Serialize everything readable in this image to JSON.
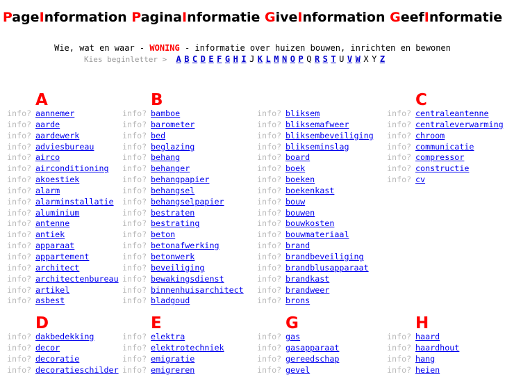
{
  "title": [
    {
      "cap": "P",
      "rest": "age"
    },
    {
      "cap": "I",
      "rest": "nformation "
    },
    {
      "cap": "P",
      "rest": "agina"
    },
    {
      "cap": "I",
      "rest": "nformatie "
    },
    {
      "cap": "G",
      "rest": "ive"
    },
    {
      "cap": "I",
      "rest": "nformation "
    },
    {
      "cap": "G",
      "rest": "eef"
    },
    {
      "cap": "I",
      "rest": "nformatie"
    }
  ],
  "tagline": {
    "before": "Wie, wat en waar - ",
    "highlight": "WONING",
    "after": " - informatie over huizen bouwen, inrichten en bewonen"
  },
  "letter_nav": {
    "label": "Kies beginletter >",
    "letters": [
      {
        "l": "A",
        "on": true
      },
      {
        "l": "B",
        "on": true
      },
      {
        "l": "C",
        "on": true
      },
      {
        "l": "D",
        "on": true
      },
      {
        "l": "E",
        "on": true
      },
      {
        "l": "F",
        "on": true
      },
      {
        "l": "G",
        "on": true
      },
      {
        "l": "H",
        "on": true
      },
      {
        "l": "I",
        "on": true
      },
      {
        "l": "J",
        "on": false
      },
      {
        "l": "K",
        "on": true
      },
      {
        "l": "L",
        "on": true
      },
      {
        "l": "M",
        "on": true
      },
      {
        "l": "N",
        "on": true
      },
      {
        "l": "O",
        "on": true
      },
      {
        "l": "P",
        "on": true
      },
      {
        "l": "Q",
        "on": false
      },
      {
        "l": "R",
        "on": true
      },
      {
        "l": "S",
        "on": true
      },
      {
        "l": "T",
        "on": true
      },
      {
        "l": "U",
        "on": false
      },
      {
        "l": "V",
        "on": true
      },
      {
        "l": "W",
        "on": true
      },
      {
        "l": "X",
        "on": false
      },
      {
        "l": "Y",
        "on": false
      },
      {
        "l": "Z",
        "on": true
      }
    ]
  },
  "info_label": "info?",
  "colors": {
    "accent": "#ff0000",
    "link": "#0000ee",
    "muted": "#bbbbbb"
  },
  "blocks": [
    {
      "columns": [
        {
          "header": "A",
          "items": [
            "aannemer",
            "aarde",
            "aardewerk",
            "adviesbureau",
            "airco",
            "airconditioning",
            "akoestiek",
            "alarm",
            "alarminstallatie",
            "aluminium",
            "antenne",
            "antiek",
            "apparaat",
            "appartement",
            "architect",
            "architectenbureau",
            "artikel",
            "asbest"
          ]
        },
        {
          "header": "B",
          "items": [
            "bamboe",
            "barometer",
            "bed",
            "beglazing",
            "behang",
            "behanger",
            "behangpapier",
            "behangsel",
            "behangselpapier",
            "bestraten",
            "bestrating",
            "beton",
            "betonafwerking",
            "betonwerk",
            "beveiliging",
            "bewakingsdienst",
            "binnenhuisarchitect",
            "bladgoud"
          ]
        },
        {
          "header": "",
          "items": [
            "bliksem",
            "bliksemafweer",
            "bliksembeveiliging",
            "blikseminslag",
            "board",
            "boek",
            "boeken",
            "boekenkast",
            "bouw",
            "bouwen",
            "bouwkosten",
            "bouwmateriaal",
            "brand",
            "brandbeveiliging",
            "brandblusapparaat",
            "brandkast",
            "brandweer",
            "brons"
          ]
        },
        {
          "header": "C",
          "items": [
            "centraleantenne",
            "centraleverwarming",
            "chroom",
            "communicatie",
            "compressor",
            "constructie",
            "cv"
          ]
        }
      ]
    },
    {
      "columns": [
        {
          "header": "D",
          "items": [
            "dakbedekking",
            "decor",
            "decoratie",
            "decoratieschilder"
          ]
        },
        {
          "header": "E",
          "items": [
            "elektra",
            "elektrotechniek",
            "emigratie",
            "emigreren"
          ]
        },
        {
          "header": "G",
          "items": [
            "gas",
            "gasapparaat",
            "gereedschap",
            "gevel"
          ]
        },
        {
          "header": "H",
          "items": [
            "haard",
            "haardhout",
            "hang",
            "heien"
          ]
        }
      ]
    }
  ]
}
